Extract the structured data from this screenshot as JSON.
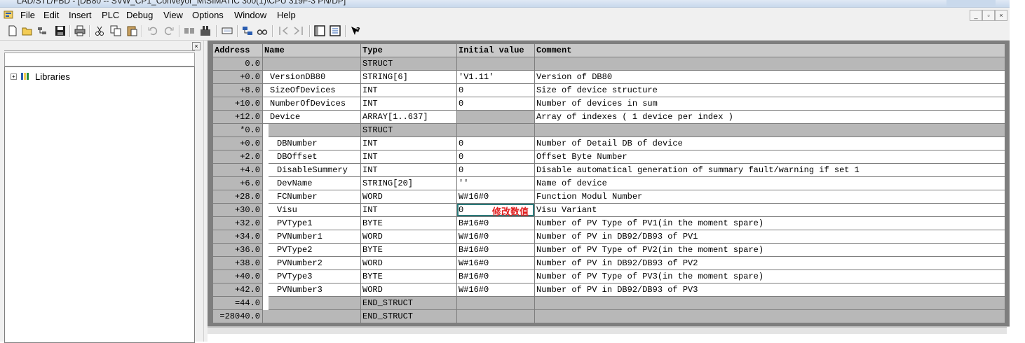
{
  "titlebar": {
    "text": "LAD/STL/FBD - [DB80 -- SVW_CP1_Conveyor_M\\SIMATIC 300(1)\\CPU 319F-3 PN/DP]"
  },
  "menu": [
    "File",
    "Edit",
    "Insert",
    "PLC",
    "Debug",
    "View",
    "Options",
    "Window",
    "Help"
  ],
  "mdi_buttons": [
    "_",
    "▫",
    "×"
  ],
  "left_panel": {
    "close": "×",
    "tree_expander": "+",
    "tree_root": "Libraries"
  },
  "table": {
    "headers": [
      "Address",
      "Name",
      "Type",
      "Initial value",
      "Comment"
    ],
    "rows": [
      {
        "address": "0.0",
        "name": "",
        "type": "STRUCT",
        "init": "",
        "comment": "",
        "kind": "struct"
      },
      {
        "address": "+0.0",
        "name": "VersionDB80",
        "type": "STRING[6]",
        "init": "'V1.11'",
        "comment": " Version of DB80",
        "kind": "l1"
      },
      {
        "address": "+8.0",
        "name": "SizeOfDevices",
        "type": "INT",
        "init": "0",
        "comment": "Size of device structure",
        "kind": "l1"
      },
      {
        "address": "+10.0",
        "name": "NumberOfDevices",
        "type": "INT",
        "init": "0",
        "comment": "Number of devices in sum",
        "kind": "l1"
      },
      {
        "address": "+12.0",
        "name": "Device",
        "type": "ARRAY[1..637]",
        "init": "",
        "comment": "Array of indexes ( 1 device per index )",
        "kind": "array"
      },
      {
        "address": "*0.0",
        "name": "",
        "type": "STRUCT",
        "init": "",
        "comment": "",
        "kind": "inner_struct"
      },
      {
        "address": "+0.0",
        "name": "DBNumber",
        "type": "INT",
        "init": "0",
        "comment": "Number of Detail DB of device",
        "kind": "l2"
      },
      {
        "address": "+2.0",
        "name": "DBOffset",
        "type": "INT",
        "init": "0",
        "comment": "Offset Byte Number",
        "kind": "l2"
      },
      {
        "address": "+4.0",
        "name": "DisableSummery",
        "type": "INT",
        "init": "0",
        "comment": "Disable automatical generation of summary fault/warning if set 1",
        "kind": "l2"
      },
      {
        "address": "+6.0",
        "name": "DevName",
        "type": "STRING[20]",
        "init": "''",
        "comment": "Name of device",
        "kind": "l2"
      },
      {
        "address": "+28.0",
        "name": "FCNumber",
        "type": "WORD",
        "init": "W#16#0",
        "comment": "Function Modul Number",
        "kind": "l2"
      },
      {
        "address": "+30.0",
        "name": "Visu",
        "type": "INT",
        "init": "0",
        "comment": "Visu Variant",
        "kind": "l2",
        "editing": true
      },
      {
        "address": "+32.0",
        "name": "PVType1",
        "type": "BYTE",
        "init": "B#16#0",
        "comment": "Number of PV Type of PV1(in the moment spare)",
        "kind": "l2"
      },
      {
        "address": "+34.0",
        "name": "PVNumber1",
        "type": "WORD",
        "init": "W#16#0",
        "comment": "Number of PV in DB92/DB93 of PV1",
        "kind": "l2"
      },
      {
        "address": "+36.0",
        "name": "PVType2",
        "type": "BYTE",
        "init": "B#16#0",
        "comment": "Number of PV Type of PV2(in the moment spare)",
        "kind": "l2"
      },
      {
        "address": "+38.0",
        "name": "PVNumber2",
        "type": "WORD",
        "init": "W#16#0",
        "comment": "Number of PV in DB92/DB93 of PV2",
        "kind": "l2"
      },
      {
        "address": "+40.0",
        "name": "PVType3",
        "type": "BYTE",
        "init": "B#16#0",
        "comment": "Number of PV Type of PV3(in the moment spare)",
        "kind": "l2"
      },
      {
        "address": "+42.0",
        "name": "PVNumber3",
        "type": "WORD",
        "init": "W#16#0",
        "comment": "Number of PV in DB92/DB93 of PV3",
        "kind": "l2"
      },
      {
        "address": "=44.0",
        "name": "",
        "type": "END_STRUCT",
        "init": "",
        "comment": "",
        "kind": "inner_end"
      },
      {
        "address": "=28040.0",
        "name": "",
        "type": "END_STRUCT",
        "init": "",
        "comment": "",
        "kind": "end"
      }
    ]
  },
  "annotation": {
    "text": "修改数值",
    "color": "#e02020"
  },
  "colors": {
    "header_bg": "#c9c9c9",
    "gray_cell": "#b8b8b8",
    "frame": "#7e7e7e",
    "edit_outline": "#2b7a7a"
  }
}
